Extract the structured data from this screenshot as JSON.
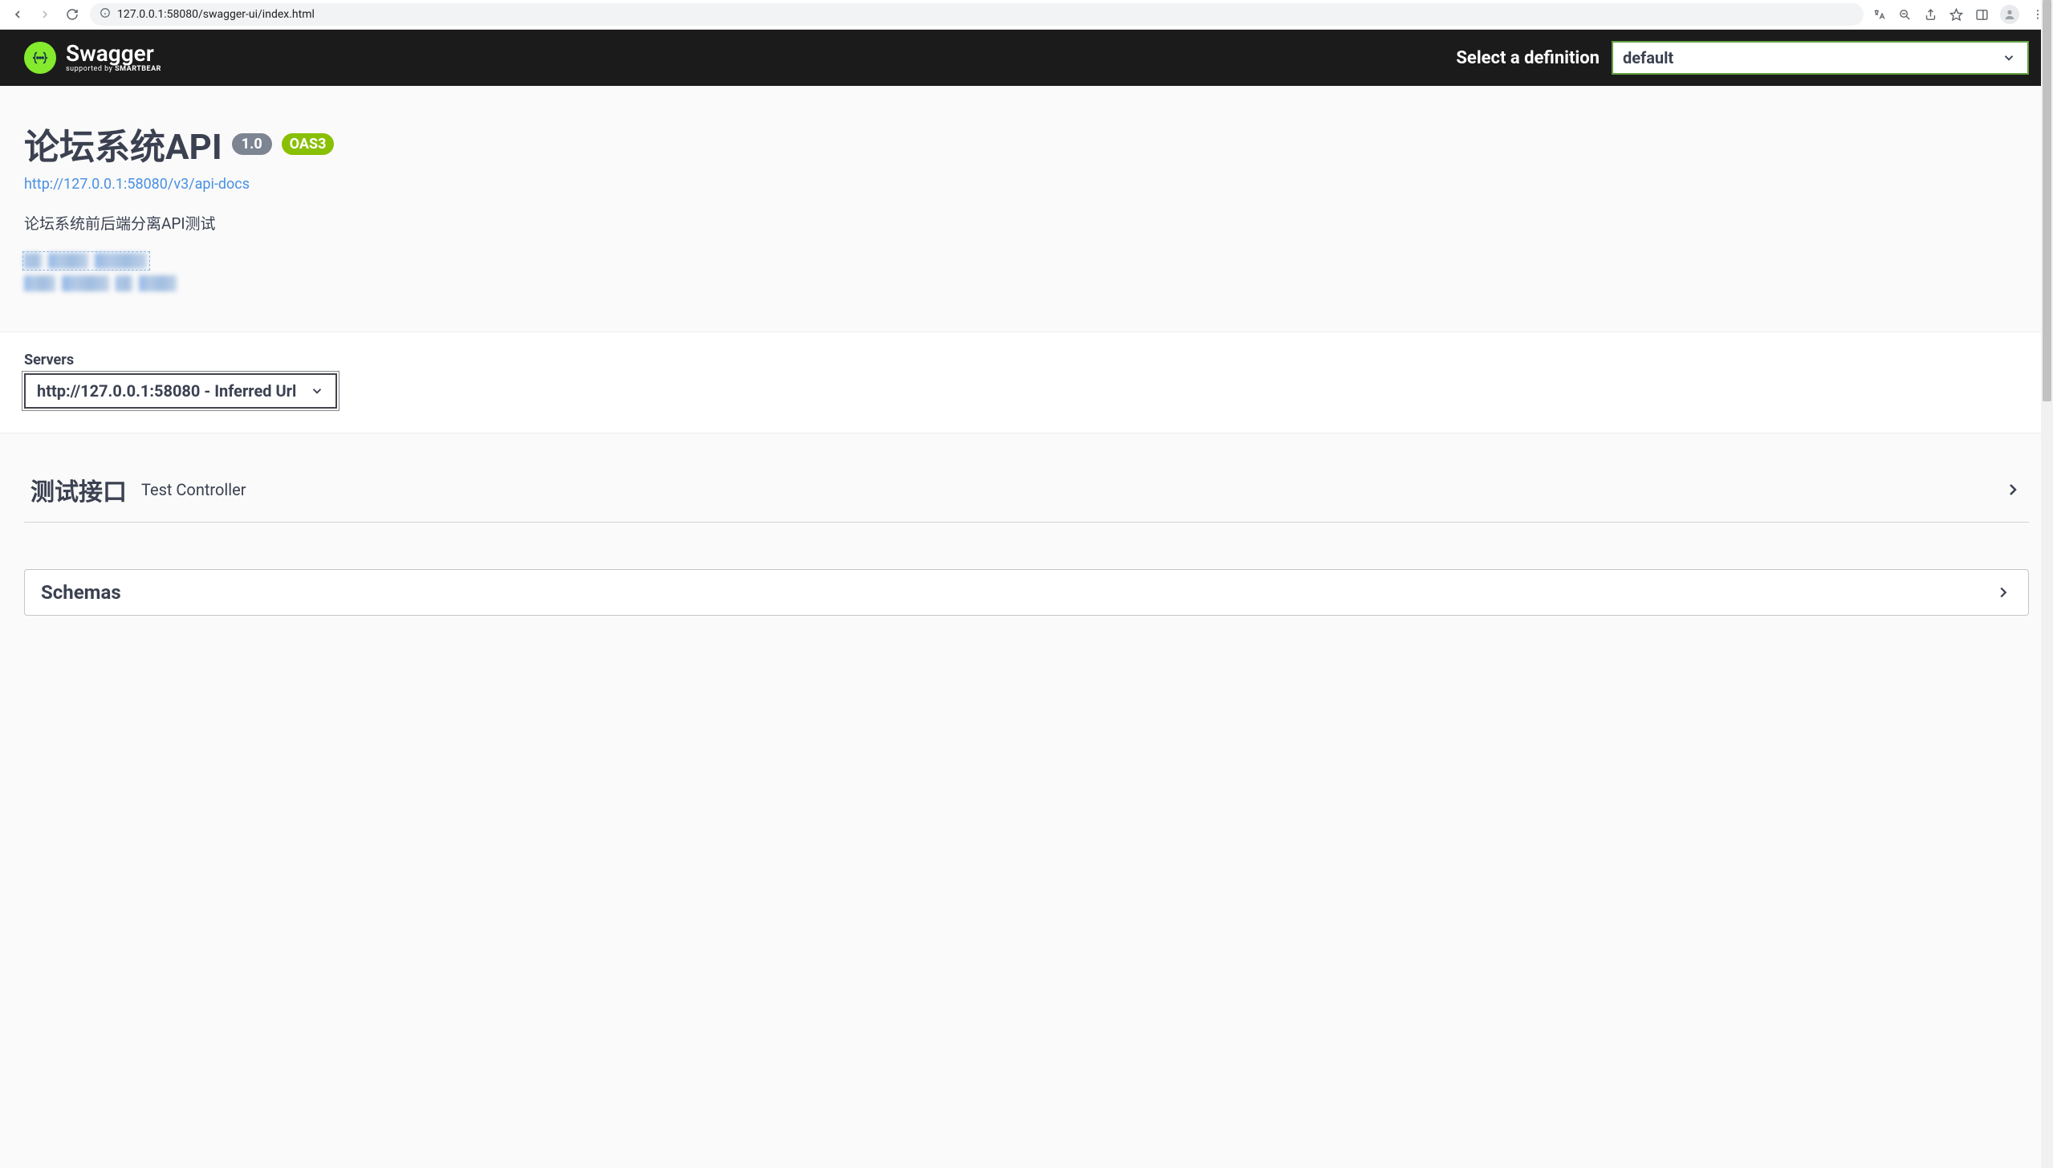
{
  "browser": {
    "url": "127.0.0.1:58080/swagger-ui/index.html"
  },
  "topbar": {
    "logo_text": "Swagger",
    "logo_supported": "supported by ",
    "logo_company": "SMARTBEAR",
    "def_label": "Select a definition",
    "def_selected": "default"
  },
  "info": {
    "title": "论坛系统API",
    "version": "1.0",
    "oas": "OAS3",
    "spec_url": "http://127.0.0.1:58080/v3/api-docs",
    "description": "论坛系统前后端分离API测试"
  },
  "servers": {
    "label": "Servers",
    "selected": "http://127.0.0.1:58080 - Inferred Url"
  },
  "tags": [
    {
      "name": "测试接口",
      "desc": "Test Controller"
    }
  ],
  "schemas": {
    "title": "Schemas"
  }
}
